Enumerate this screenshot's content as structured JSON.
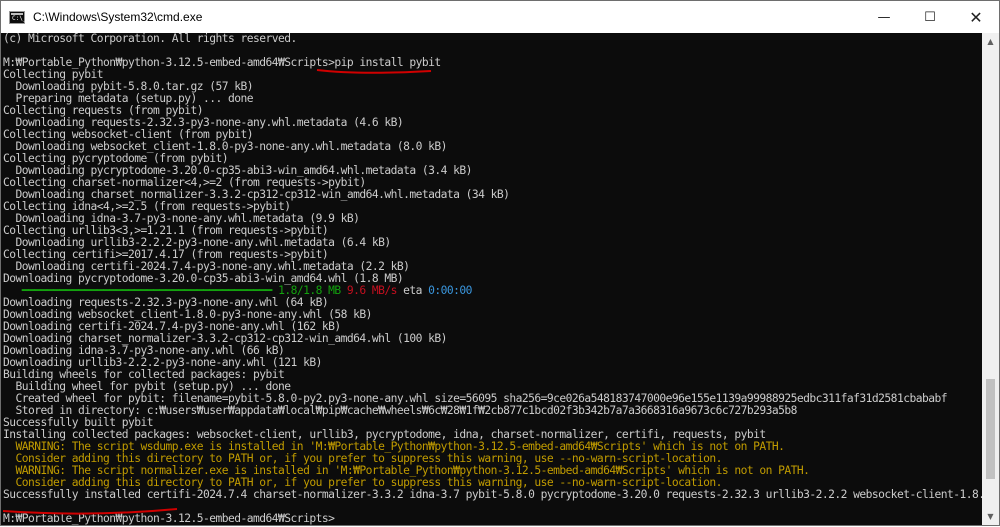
{
  "window": {
    "title": "C:\\Windows\\System32\\cmd.exe",
    "minimize_glyph": "—",
    "maximize_glyph": "☐",
    "close_glyph": "✕",
    "icon": "cmd-icon",
    "icon_prompt": "C:\\_"
  },
  "scrollbar": {
    "up_glyph": "▲",
    "down_glyph": "▼",
    "thumb_position": 0.92,
    "thumb_size": 0.22
  },
  "colors": {
    "background": "#0c0c0c",
    "text": "#cccccc",
    "warning": "#c19c00",
    "progress": "#13a10e",
    "speed": "#c50f1f",
    "eta": "#3a96dd",
    "annotation": "#d00000"
  },
  "console_lines": [
    [
      {
        "t": "(c) Microsoft Corporation. All rights reserved."
      }
    ],
    [
      {
        "t": ""
      }
    ],
    [
      {
        "t": "M:₩Portable_Python₩python-3.12.5-embed-amd64₩Scripts>pip install pybit"
      }
    ],
    [
      {
        "t": "Collecting pybit"
      }
    ],
    [
      {
        "t": "  Downloading pybit-5.8.0.tar.gz (57 kB)"
      }
    ],
    [
      {
        "t": "  Preparing metadata (setup.py) ... done"
      }
    ],
    [
      {
        "t": "Collecting requests (from pybit)"
      }
    ],
    [
      {
        "t": "  Downloading requests-2.32.3-py3-none-any.whl.metadata (4.6 kB)"
      }
    ],
    [
      {
        "t": "Collecting websocket-client (from pybit)"
      }
    ],
    [
      {
        "t": "  Downloading websocket_client-1.8.0-py3-none-any.whl.metadata (8.0 kB)"
      }
    ],
    [
      {
        "t": "Collecting pycryptodome (from pybit)"
      }
    ],
    [
      {
        "t": "  Downloading pycryptodome-3.20.0-cp35-abi3-win_amd64.whl.metadata (3.4 kB)"
      }
    ],
    [
      {
        "t": "Collecting charset-normalizer<4,>=2 (from requests->pybit)"
      }
    ],
    [
      {
        "t": "  Downloading charset_normalizer-3.3.2-cp312-cp312-win_amd64.whl.metadata (34 kB)"
      }
    ],
    [
      {
        "t": "Collecting idna<4,>=2.5 (from requests->pybit)"
      }
    ],
    [
      {
        "t": "  Downloading idna-3.7-py3-none-any.whl.metadata (9.9 kB)"
      }
    ],
    [
      {
        "t": "Collecting urllib3<3,>=1.21.1 (from requests->pybit)"
      }
    ],
    [
      {
        "t": "  Downloading urllib3-2.2.2-py3-none-any.whl.metadata (6.4 kB)"
      }
    ],
    [
      {
        "t": "Collecting certifi>=2017.4.17 (from requests->pybit)"
      }
    ],
    [
      {
        "t": "  Downloading certifi-2024.7.4-py3-none-any.whl.metadata (2.2 kB)"
      }
    ],
    [
      {
        "t": "Downloading pycryptodome-3.20.0-cp35-abi3-win_amd64.whl (1.8 MB)"
      }
    ],
    [
      {
        "t": "   ━━━━━━━━━━━━━━━━━━━━━━━━━━━━━━━━━━━━━━━━ ",
        "c": "green"
      },
      {
        "t": "1.8/1.8 MB",
        "c": "green"
      },
      {
        "t": " "
      },
      {
        "t": "9.6 MB/s",
        "c": "red"
      },
      {
        "t": " eta "
      },
      {
        "t": "0:00:00",
        "c": "cyan"
      }
    ],
    [
      {
        "t": "Downloading requests-2.32.3-py3-none-any.whl (64 kB)"
      }
    ],
    [
      {
        "t": "Downloading websocket_client-1.8.0-py3-none-any.whl (58 kB)"
      }
    ],
    [
      {
        "t": "Downloading certifi-2024.7.4-py3-none-any.whl (162 kB)"
      }
    ],
    [
      {
        "t": "Downloading charset_normalizer-3.3.2-cp312-cp312-win_amd64.whl (100 kB)"
      }
    ],
    [
      {
        "t": "Downloading idna-3.7-py3-none-any.whl (66 kB)"
      }
    ],
    [
      {
        "t": "Downloading urllib3-2.2.2-py3-none-any.whl (121 kB)"
      }
    ],
    [
      {
        "t": "Building wheels for collected packages: pybit"
      }
    ],
    [
      {
        "t": "  Building wheel for pybit (setup.py) ... done"
      }
    ],
    [
      {
        "t": "  Created wheel for pybit: filename=pybit-5.8.0-py2.py3-none-any.whl size=56095 sha256=9ce026a548183747000e96e155e1139a99988925edbc311faf31d2581cbababf"
      }
    ],
    [
      {
        "t": "  Stored in directory: c:₩users₩user₩appdata₩local₩pip₩cache₩wheels₩6c₩28₩1f₩2cb877c1bcd02f3b342b7a7a3668316a9673c6c727b293a5b8"
      }
    ],
    [
      {
        "t": "Successfully built pybit"
      }
    ],
    [
      {
        "t": "Installing collected packages: websocket-client, urllib3, pycryptodome, idna, charset-normalizer, certifi, requests, pybit"
      }
    ],
    [
      {
        "t": "  WARNING: The script wsdump.exe is installed in 'M:₩Portable_Python₩python-3.12.5-embed-amd64₩Scripts' which is not on PATH.",
        "c": "warn"
      }
    ],
    [
      {
        "t": "  Consider adding this directory to PATH or, if you prefer to suppress this warning, use --no-warn-script-location.",
        "c": "warn"
      }
    ],
    [
      {
        "t": "  WARNING: The script normalizer.exe is installed in 'M:₩Portable_Python₩python-3.12.5-embed-amd64₩Scripts' which is not on PATH.",
        "c": "warn"
      }
    ],
    [
      {
        "t": "  Consider adding this directory to PATH or, if you prefer to suppress this warning, use --no-warn-script-location.",
        "c": "warn"
      }
    ],
    [
      {
        "t": "Successfully installed certifi-2024.7.4 charset-normalizer-3.3.2 idna-3.7 pybit-5.8.0 pycryptodome-3.20.0 requests-2.32.3 urllib3-2.2.2 websocket-client-1.8.0"
      }
    ],
    [
      {
        "t": ""
      }
    ],
    [
      {
        "t": "M:₩Portable_Python₩python-3.12.5-embed-amd64₩Scripts>"
      }
    ]
  ]
}
